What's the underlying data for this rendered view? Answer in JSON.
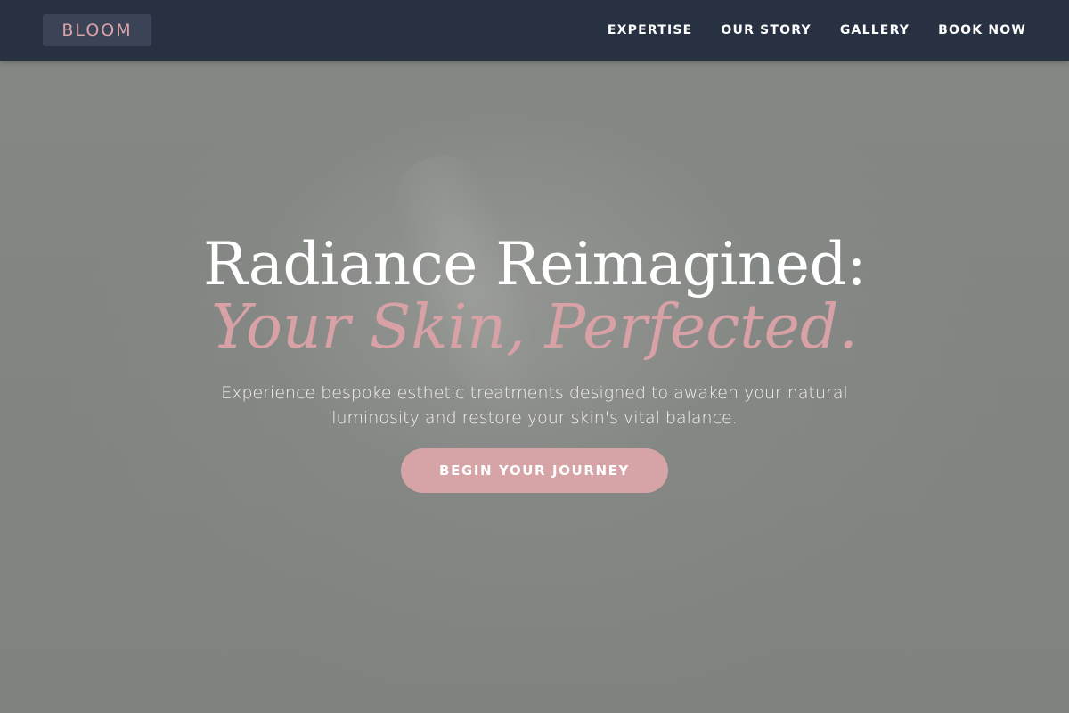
{
  "brand": {
    "logo_text": "BLOOM"
  },
  "nav": {
    "items": [
      {
        "label": "EXPERTISE"
      },
      {
        "label": "OUR STORY"
      },
      {
        "label": "GALLERY"
      },
      {
        "label": "BOOK NOW"
      }
    ]
  },
  "hero": {
    "headline_line1": "Radiance Reimagined:",
    "headline_line2": "Your Skin, Perfected.",
    "subtext": "Experience bespoke esthetic treatments designed to awaken your natural luminosity and restore your skin's vital balance.",
    "cta_label": "BEGIN YOUR JOURNEY"
  },
  "colors": {
    "navbar_bg": "#283142",
    "accent_pink": "#d6a3a6",
    "hero_bg": "#8b8f8a"
  }
}
